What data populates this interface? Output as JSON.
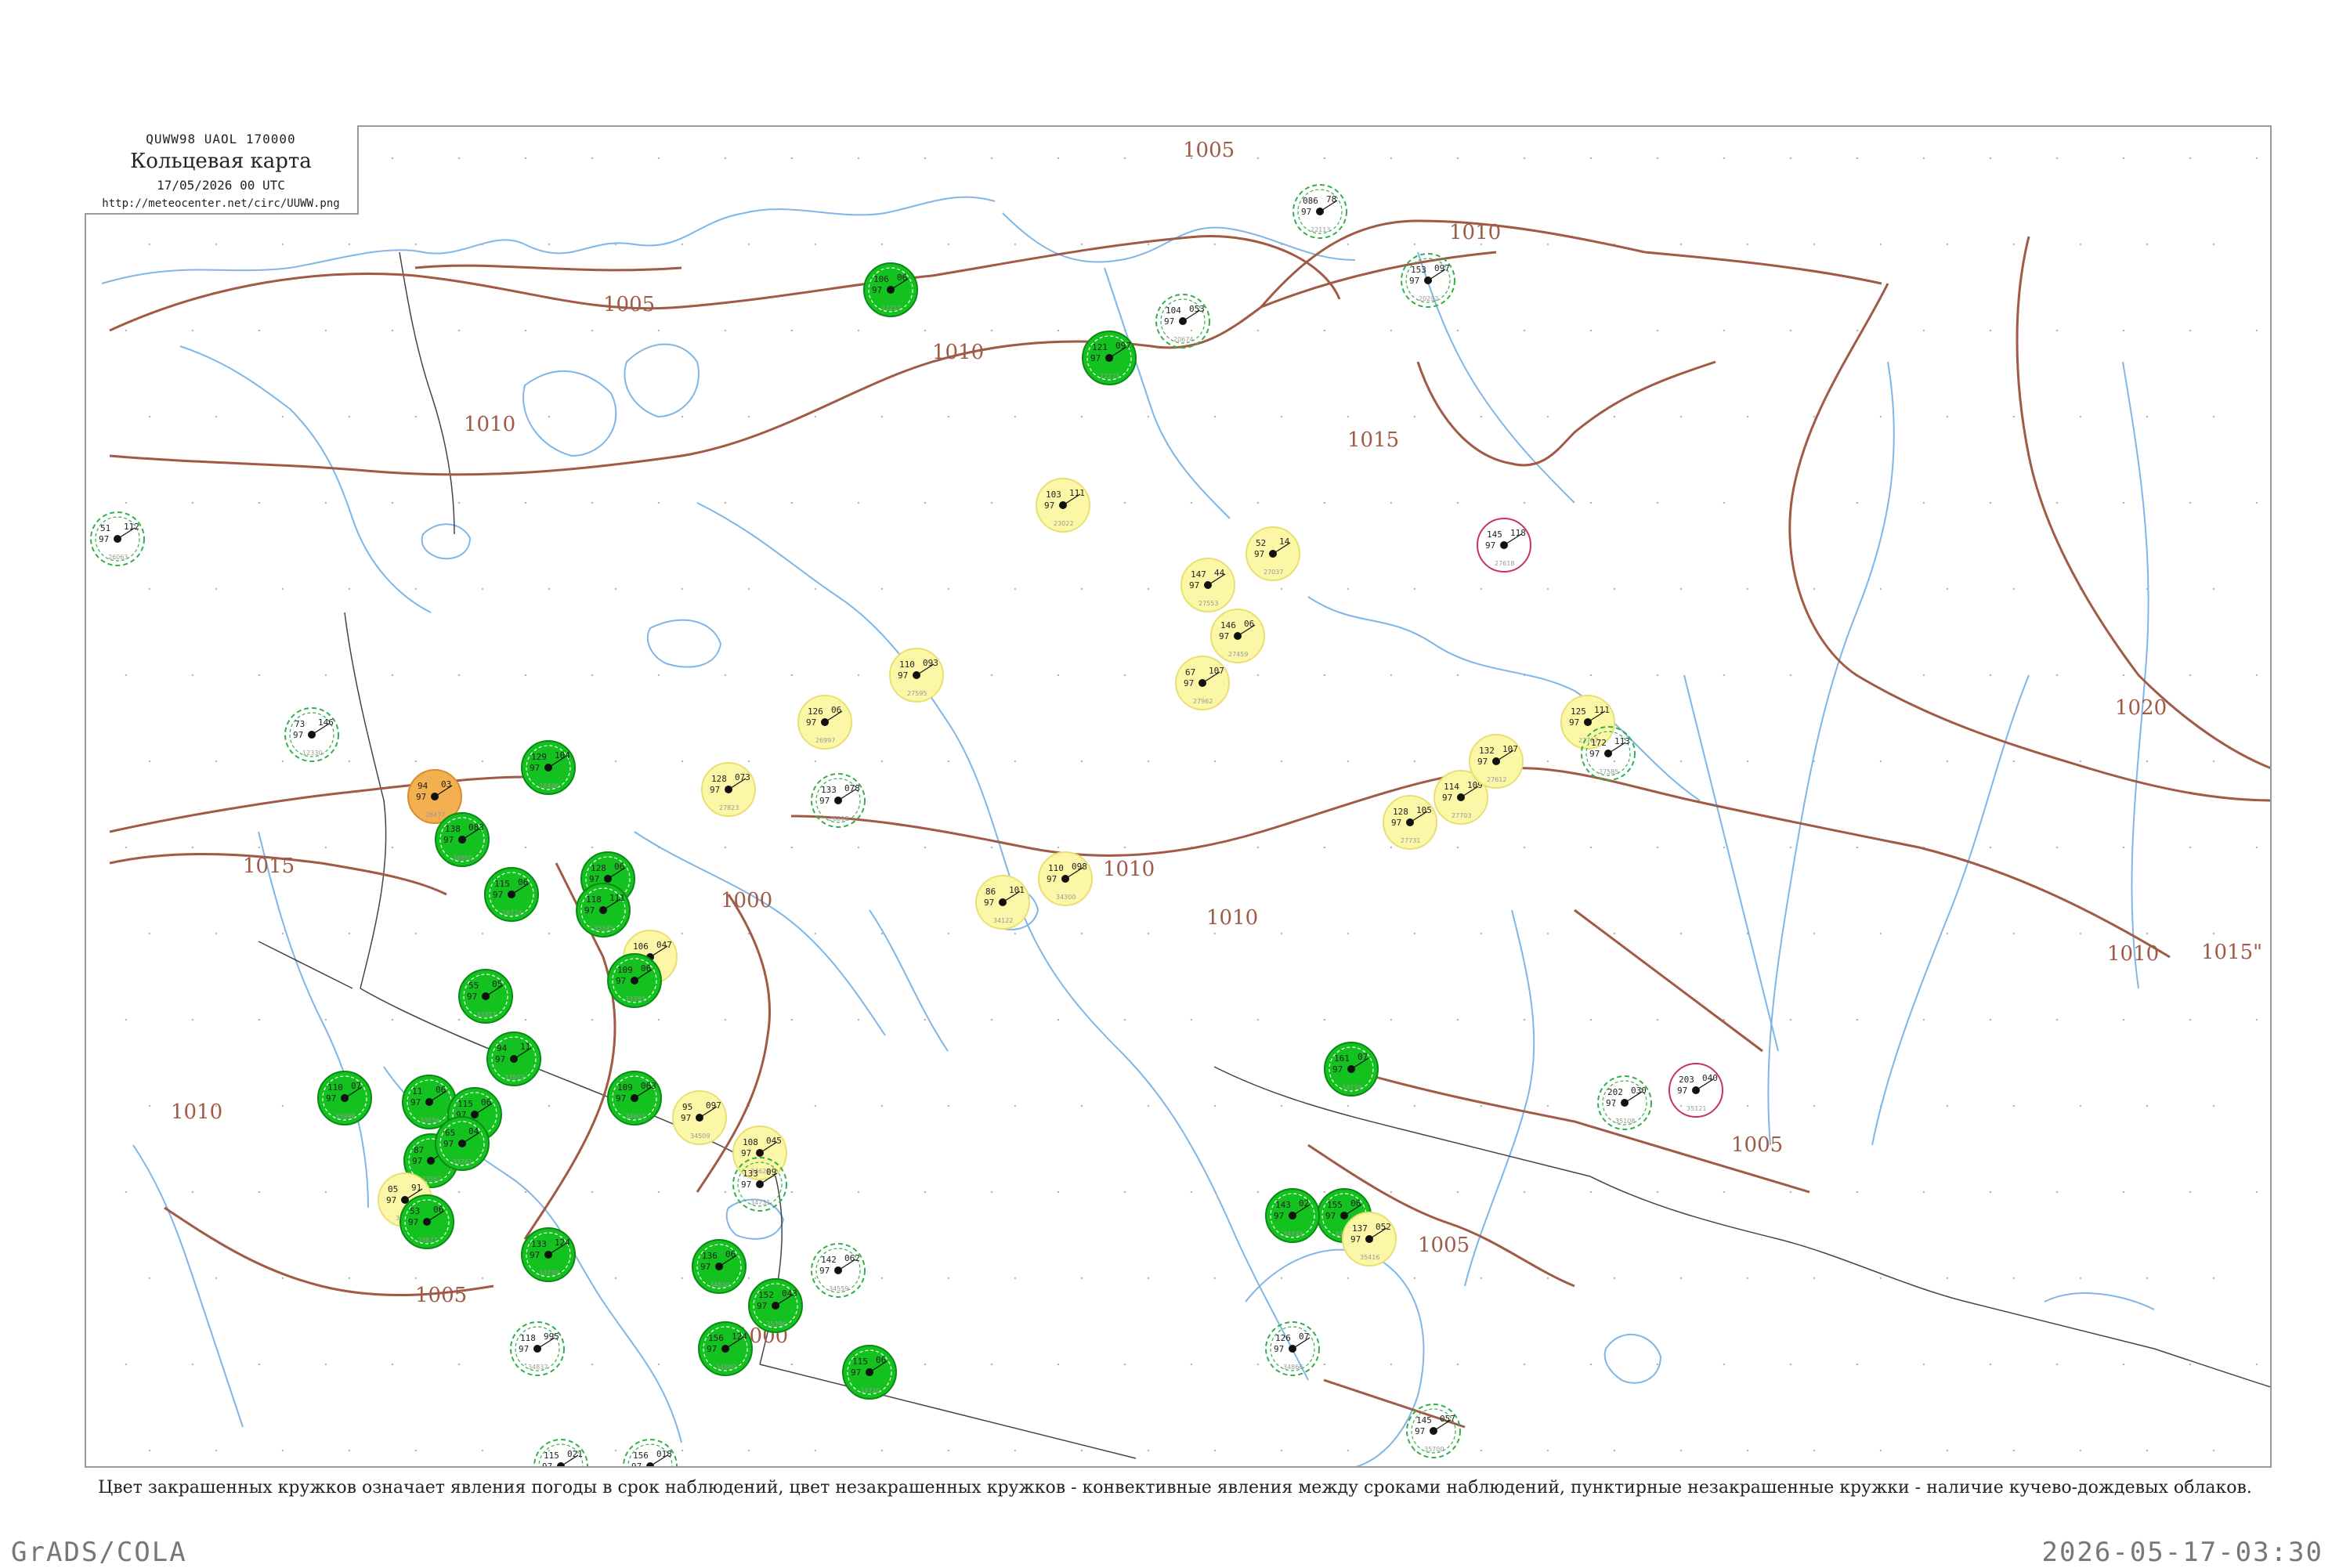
{
  "header": {
    "code": "QUWW98  UAOL  170000",
    "title": "Кольцевая карта",
    "valid_time": "17/05/2026 00 UTC",
    "url": "http://meteocenter.net/circ/UUWW.png"
  },
  "caption": "Цвет закрашенных кружков означает явления погоды в срок наблюдений, цвет незакрашенных кружков - конвективные явления между сроками наблюдений, пунктирные незакрашенные кружки - наличие кучево-дождевых облаков.",
  "footer": {
    "left": "GrADS/COLA",
    "right": "2026-05-17-03:30"
  },
  "colors": {
    "isobar": "#a05a45",
    "water": "#7fb6e6",
    "border": "#9a9a9a",
    "rain": "#13c21f",
    "rain_dark": "#0a8a14",
    "shower": "#f7f36b",
    "haze": "#fbf7a6",
    "dust": "#f2b050",
    "thunder": "#c8345a",
    "cb_dashed": "#33b04a"
  },
  "isobar_labels": [
    "1005",
    "1010",
    "1015",
    "1020",
    "1000"
  ],
  "isobars": [
    {
      "value": "1005",
      "label": "1005"
    },
    {
      "value": "1005",
      "label": "1005"
    },
    {
      "value": "1010",
      "label": "1010"
    },
    {
      "value": "1010",
      "label": "1010"
    },
    {
      "value": "1010",
      "label": "1010"
    },
    {
      "value": "1010",
      "label": "1010"
    },
    {
      "value": "1010",
      "label": "1010"
    },
    {
      "value": "1015",
      "label": "1015"
    },
    {
      "value": "1015",
      "label": "1015"
    },
    {
      "value": "1015",
      "label": "1015\""
    },
    {
      "value": "1020",
      "label": "1020"
    },
    {
      "value": "1000",
      "label": "1000"
    },
    {
      "value": "1000",
      "label": "1000"
    },
    {
      "value": "1005",
      "label": "1005"
    },
    {
      "value": "1005",
      "label": "1005"
    },
    {
      "value": "1005",
      "label": "1005"
    },
    {
      "value": "1010",
      "label": "1010"
    },
    {
      "value": "1010",
      "label": "1010"
    }
  ],
  "stations": [
    {
      "id": "22217",
      "t": "97",
      "p": "106",
      "td": "06",
      "phen": "rain"
    },
    {
      "id": "22113",
      "t": "97",
      "p": "086",
      "td": "78",
      "phen": "cb"
    },
    {
      "id": "20674",
      "t": "97",
      "p": "104",
      "td": "053",
      "phen": "cb"
    },
    {
      "id": "20292",
      "t": "97",
      "p": "153",
      "td": "097",
      "phen": "cb"
    },
    {
      "id": "22271",
      "t": "97",
      "p": "121",
      "td": "097",
      "phen": "rain"
    },
    {
      "id": "23022",
      "t": "97",
      "p": "103",
      "td": "111",
      "phen": "shower"
    },
    {
      "id": "27037",
      "t": "97",
      "p": "52",
      "td": "14",
      "phen": "shower"
    },
    {
      "id": "27553",
      "t": "97",
      "p": "147",
      "td": "44",
      "phen": "shower"
    },
    {
      "id": "27459",
      "t": "97",
      "p": "146",
      "td": "06",
      "phen": "shower"
    },
    {
      "id": "27962",
      "t": "97",
      "p": "67",
      "td": "107",
      "phen": "shower"
    },
    {
      "id": "27595",
      "t": "97",
      "p": "110",
      "td": "093",
      "phen": "shower"
    },
    {
      "id": "26997",
      "t": "97",
      "p": "126",
      "td": "06",
      "phen": "shower"
    },
    {
      "id": "26898",
      "t": "97",
      "p": "133",
      "td": "078",
      "phen": "cb"
    },
    {
      "id": "27823",
      "t": "97",
      "p": "128",
      "td": "073",
      "phen": "shower"
    },
    {
      "id": "26406",
      "t": "97",
      "p": "129",
      "td": "104",
      "phen": "rain"
    },
    {
      "id": "26477",
      "t": "97",
      "p": "94",
      "td": "03",
      "phen": "dust"
    },
    {
      "id": "26850",
      "t": "97",
      "p": "138",
      "td": "083",
      "phen": "rain"
    },
    {
      "id": "26724",
      "t": "97",
      "p": "115",
      "td": "06",
      "phen": "rain"
    },
    {
      "id": "33791",
      "t": "97",
      "p": "128",
      "td": "06",
      "phen": "rain"
    },
    {
      "id": "33889",
      "t": "97",
      "p": "106",
      "td": "047",
      "phen": "shower"
    },
    {
      "id": "34122",
      "t": "97",
      "p": "86",
      "td": "101",
      "phen": "shower"
    },
    {
      "id": "34300",
      "t": "97",
      "p": "110",
      "td": "098",
      "phen": "shower"
    },
    {
      "id": "27703",
      "t": "97",
      "p": "114",
      "td": "109",
      "phen": "shower"
    },
    {
      "id": "27731",
      "t": "97",
      "p": "128",
      "td": "105",
      "phen": "shower"
    },
    {
      "id": "27707",
      "t": "97",
      "p": "125",
      "td": "111",
      "phen": "shower"
    },
    {
      "id": "27612",
      "t": "97",
      "p": "132",
      "td": "107",
      "phen": "shower"
    },
    {
      "id": "27618",
      "t": "97",
      "p": "145",
      "td": "118",
      "phen": "thunder"
    },
    {
      "id": "27585",
      "t": "97",
      "p": "172",
      "td": "113",
      "phen": "cb"
    },
    {
      "id": "33345",
      "t": "97",
      "p": "118",
      "td": "111",
      "phen": "rain"
    },
    {
      "id": "33393",
      "t": "97",
      "p": "109",
      "td": "06",
      "phen": "rain"
    },
    {
      "id": "33317",
      "t": "97",
      "p": "55",
      "td": "05",
      "phen": "rain"
    },
    {
      "id": "33503",
      "t": "97",
      "p": "94",
      "td": "11",
      "phen": "rain"
    },
    {
      "id": "33562",
      "t": "97",
      "p": "87",
      "td": "08",
      "phen": "rain"
    },
    {
      "id": "34601",
      "t": "97",
      "p": "109",
      "td": "063",
      "phen": "rain"
    },
    {
      "id": "34509",
      "t": "97",
      "p": "95",
      "td": "097",
      "phen": "shower"
    },
    {
      "id": "34621",
      "t": "97",
      "p": "108",
      "td": "045",
      "phen": "shower"
    },
    {
      "id": "34731",
      "t": "97",
      "p": "133",
      "td": "09",
      "phen": "cb"
    },
    {
      "id": "34559",
      "t": "97",
      "p": "142",
      "td": "062",
      "phen": "cb"
    },
    {
      "id": "34720",
      "t": "97",
      "p": "115",
      "td": "06",
      "phen": "rain"
    },
    {
      "id": "34739",
      "t": "97",
      "p": "133",
      "td": "124",
      "phen": "rain"
    },
    {
      "id": "34838",
      "t": "97",
      "p": "136",
      "td": "06",
      "phen": "rain"
    },
    {
      "id": "34880",
      "t": "97",
      "p": "156",
      "td": "124",
      "phen": "rain"
    },
    {
      "id": "35394",
      "t": "97",
      "p": "152",
      "td": "043",
      "phen": "rain"
    },
    {
      "id": "34837",
      "t": "97",
      "p": "118",
      "td": "995",
      "phen": "cb"
    },
    {
      "id": "34929",
      "t": "97",
      "p": "115",
      "td": "021",
      "phen": "cb"
    },
    {
      "id": "37018",
      "t": "97",
      "p": "156",
      "td": "018",
      "phen": "cb"
    },
    {
      "id": "33998",
      "t": "97",
      "p": "110",
      "td": "07",
      "phen": "rain"
    },
    {
      "id": "33902",
      "t": "97",
      "p": "05",
      "td": "91",
      "phen": "shower"
    },
    {
      "id": "33877",
      "t": "97",
      "p": "53",
      "td": "06",
      "phen": "rain"
    },
    {
      "id": "33656",
      "t": "97",
      "p": "11",
      "td": "06",
      "phen": "rain"
    },
    {
      "id": "33665",
      "t": "97",
      "p": "115",
      "td": "06",
      "phen": "rain"
    },
    {
      "id": "33761",
      "t": "97",
      "p": "65",
      "td": "04",
      "phen": "rain"
    },
    {
      "id": "34139",
      "t": "97",
      "p": "161",
      "td": "07",
      "phen": "rain"
    },
    {
      "id": "34415",
      "t": "97",
      "p": "155",
      "td": "06",
      "phen": "rain"
    },
    {
      "id": "35121",
      "t": "97",
      "p": "203",
      "td": "040",
      "phen": "thunder"
    },
    {
      "id": "35108",
      "t": "97",
      "p": "202",
      "td": "030",
      "phen": "cb"
    },
    {
      "id": "34866",
      "t": "97",
      "p": "126",
      "td": "07",
      "phen": "cb"
    },
    {
      "id": "35700",
      "t": "97",
      "p": "145",
      "td": "057",
      "phen": "cb"
    },
    {
      "id": "34749",
      "t": "97",
      "p": "143",
      "td": "02",
      "phen": "rain"
    },
    {
      "id": "35416",
      "t": "97",
      "p": "137",
      "td": "052",
      "phen": "shower"
    },
    {
      "id": "12330",
      "t": "97",
      "p": "73",
      "td": "146",
      "phen": "cb"
    },
    {
      "id": "26063",
      "t": "97",
      "p": "51",
      "td": "112",
      "phen": "cb"
    }
  ]
}
